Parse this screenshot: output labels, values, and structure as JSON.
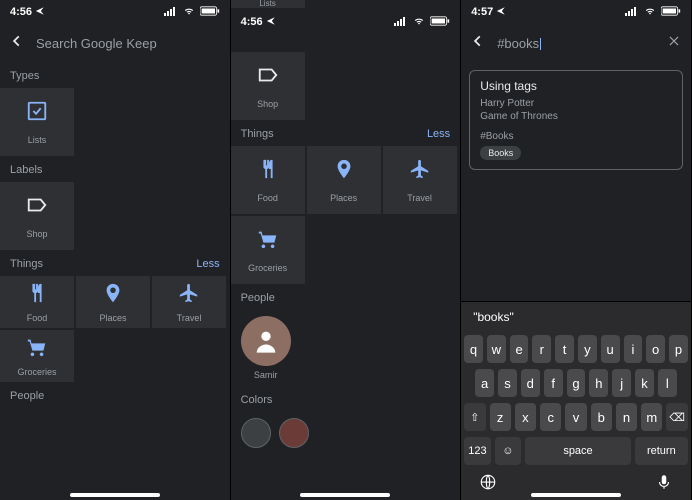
{
  "screen1": {
    "status_time": "4:56",
    "search_placeholder": "Search Google Keep",
    "sect_types": "Types",
    "tile_lists": "Lists",
    "sect_labels": "Labels",
    "tile_shop": "Shop",
    "sect_things": "Things",
    "less": "Less",
    "tile_food": "Food",
    "tile_places": "Places",
    "tile_travel": "Travel",
    "tile_groceries": "Groceries",
    "sect_people": "People"
  },
  "screen2": {
    "status_time": "4:56",
    "peek_label": "Lists",
    "tile_shop": "Shop",
    "sect_things": "Things",
    "less": "Less",
    "tile_food": "Food",
    "tile_places": "Places",
    "tile_travel": "Travel",
    "tile_groceries": "Groceries",
    "sect_people": "People",
    "person_name": "Samir",
    "sect_colors": "Colors",
    "swatch1": "#3c4043",
    "swatch2": "#6b3b37"
  },
  "screen3": {
    "status_time": "4:57",
    "search_value": "#books",
    "note_title": "Using tags",
    "note_line1": "Harry Potter",
    "note_line2": "Game of Thrones",
    "note_tag": "#Books",
    "chip": "Books",
    "suggestion": "\"books\"",
    "kb_row1": [
      "q",
      "w",
      "e",
      "r",
      "t",
      "y",
      "u",
      "i",
      "o",
      "p"
    ],
    "kb_row2": [
      "a",
      "s",
      "d",
      "f",
      "g",
      "h",
      "j",
      "k",
      "l"
    ],
    "kb_row3": [
      "z",
      "x",
      "c",
      "v",
      "b",
      "n",
      "m"
    ],
    "kb_123": "123",
    "kb_space": "space",
    "kb_return": "return"
  }
}
